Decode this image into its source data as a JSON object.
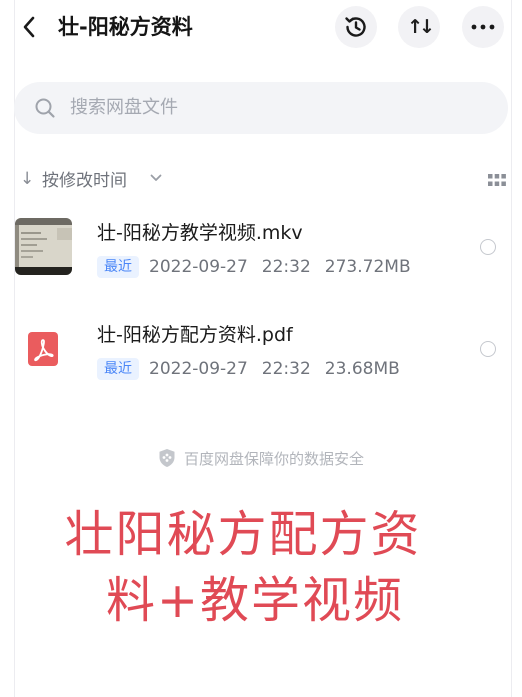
{
  "header": {
    "title": "壮-阳秘方资料",
    "back_icon": "back-chevron-icon",
    "history_icon": "history-clock-icon",
    "sort_icon": "sort-arrows-icon",
    "more_icon": "more-dots-icon"
  },
  "search": {
    "placeholder": "搜索网盘文件"
  },
  "sort": {
    "label": "按修改时间"
  },
  "files": [
    {
      "name": "壮-阳秘方教学视频.mkv",
      "badge": "最近",
      "date": "2022-09-27",
      "time": "22:32",
      "size": "273.72MB",
      "type": "video"
    },
    {
      "name": "壮-阳秘方配方资料.pdf",
      "badge": "最近",
      "date": "2022-09-27",
      "time": "22:32",
      "size": "23.68MB",
      "type": "pdf"
    }
  ],
  "footer": {
    "secure_text": "百度网盘保障你的数据安全"
  },
  "overlay": {
    "line1": "壮阳秘方配方资",
    "line2": "料+教学视频",
    "color": "#e04a55"
  }
}
